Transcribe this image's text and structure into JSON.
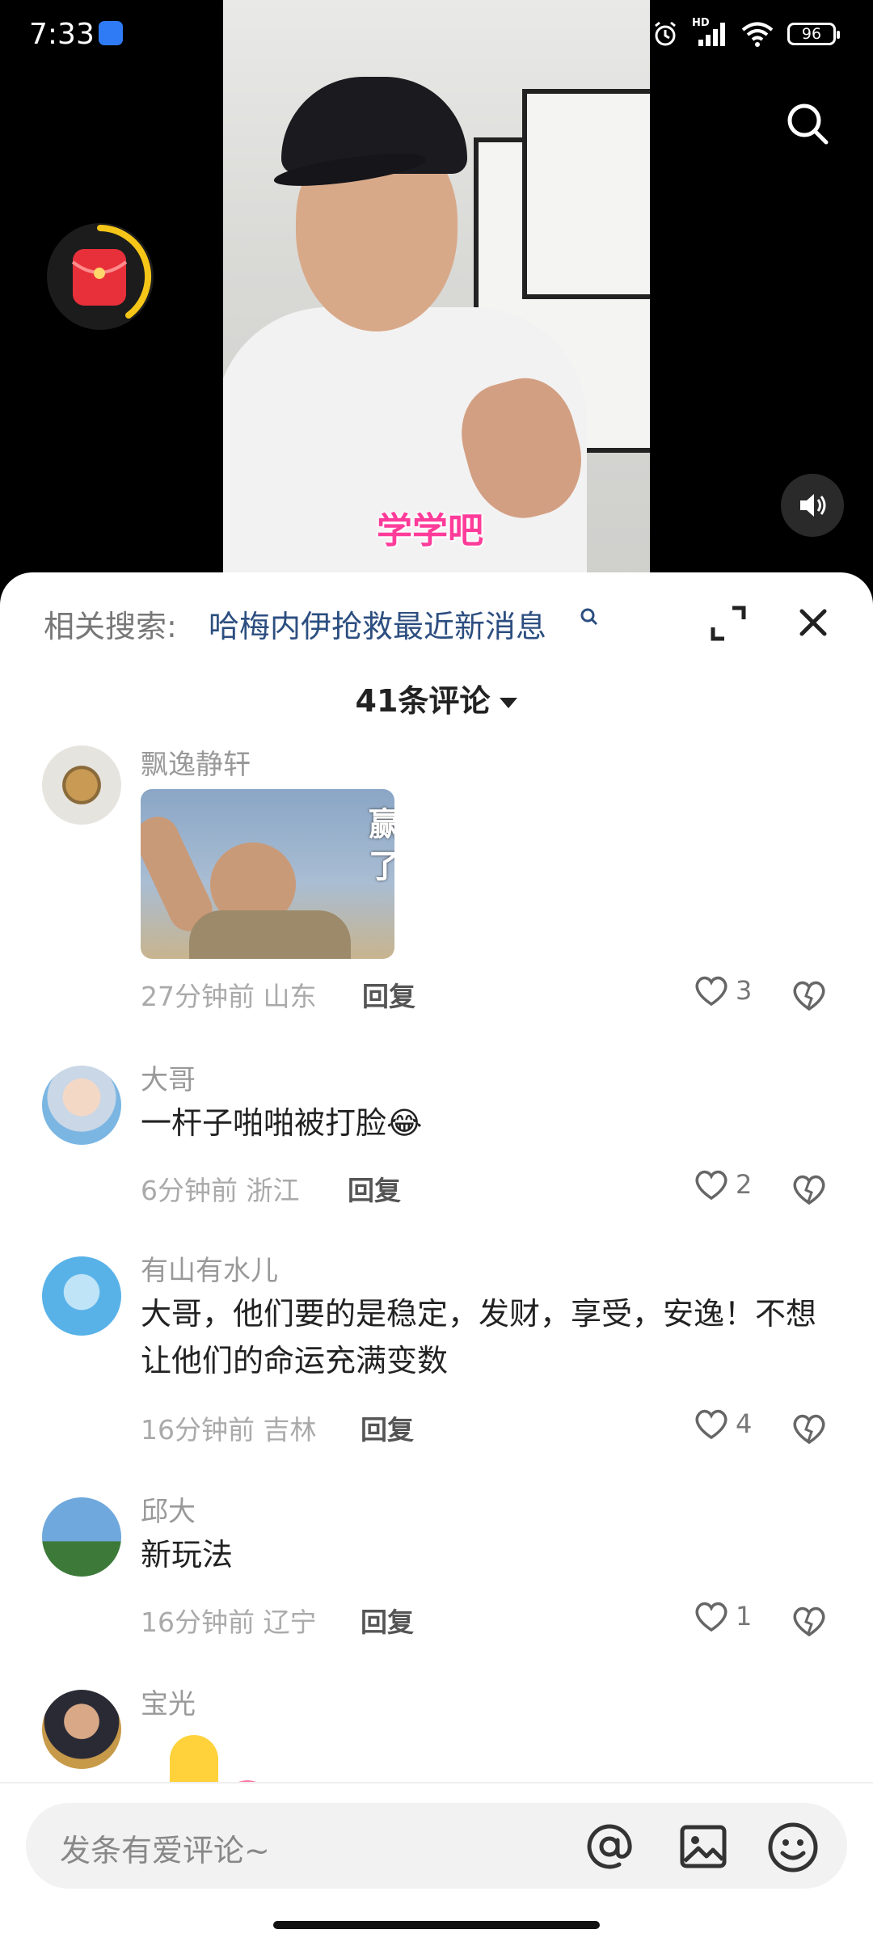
{
  "status_bar": {
    "time": "7:33",
    "network": "HD",
    "battery": "96"
  },
  "video": {
    "caption": "学学吧"
  },
  "comments_sheet": {
    "related_label": "相关搜索:",
    "related_query": "哈梅内伊抢救最近新消息",
    "count_label": "41条评论",
    "comments": [
      {
        "user": "飘逸静轩",
        "text": "",
        "sticker_text": "赢了",
        "time": "27分钟前",
        "location": "山东",
        "reply": "回复",
        "likes": "3"
      },
      {
        "user": "大哥",
        "text": "一杆子啪啪被打脸😂",
        "time": "6分钟前",
        "location": "浙江",
        "reply": "回复",
        "likes": "2"
      },
      {
        "user": "有山有水儿",
        "text": "大哥，他们要的是稳定，发财，享受，安逸！不想让他们的命运充满变数",
        "time": "16分钟前",
        "location": "吉林",
        "reply": "回复",
        "likes": "4"
      },
      {
        "user": "邱大",
        "text": "新玩法",
        "time": "16分钟前",
        "location": "辽宁",
        "reply": "回复",
        "likes": "1"
      },
      {
        "user": "宝光",
        "text": "",
        "time": "",
        "location": "",
        "reply": "",
        "likes": ""
      }
    ]
  },
  "input_bar": {
    "placeholder": "发条有爱评论~"
  },
  "colors": {
    "accent_link": "#2c4e80",
    "caption_pink": "#ff3c9a",
    "red_packet": "#e8303a",
    "timer_ring": "#f5c518"
  }
}
